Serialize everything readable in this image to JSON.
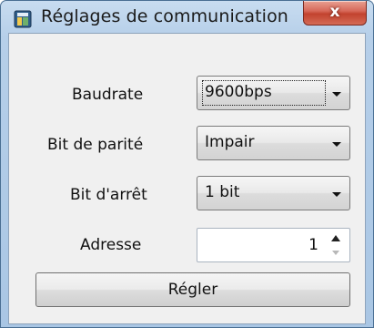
{
  "window": {
    "title": "Réglages de communication",
    "icon": "app-icon",
    "close_glyph": "x"
  },
  "form": {
    "baudrate": {
      "label": "Baudrate",
      "value": "9600bps"
    },
    "parity": {
      "label": "Bit de parité",
      "value": "Impair"
    },
    "stop_bits": {
      "label": "Bit d'arrêt",
      "value": "1 bit"
    },
    "address": {
      "label": "Adresse",
      "value": "1"
    }
  },
  "actions": {
    "apply_label": "Régler"
  },
  "colors": {
    "title_bar": "#b6cfe9",
    "client_bg": "#f0f0f0",
    "close_button": "#c2432f"
  }
}
